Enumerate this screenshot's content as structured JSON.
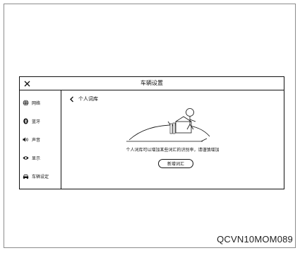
{
  "window": {
    "title": "车辆设置"
  },
  "sidebar": {
    "items": [
      {
        "label": "网络",
        "icon": "globe-icon"
      },
      {
        "label": "蓝牙",
        "icon": "bluetooth-icon"
      },
      {
        "label": "声音",
        "icon": "speaker-icon"
      },
      {
        "label": "显示",
        "icon": "eye-icon"
      },
      {
        "label": "车辆设定",
        "icon": "car-icon"
      }
    ]
  },
  "content": {
    "back_label": "个人词库",
    "empty_message": "个人词库可以增加某些词汇的识别率，请谨慎增加",
    "add_button_label": "新增词汇"
  },
  "figure_code": "QCVN10MOM089"
}
